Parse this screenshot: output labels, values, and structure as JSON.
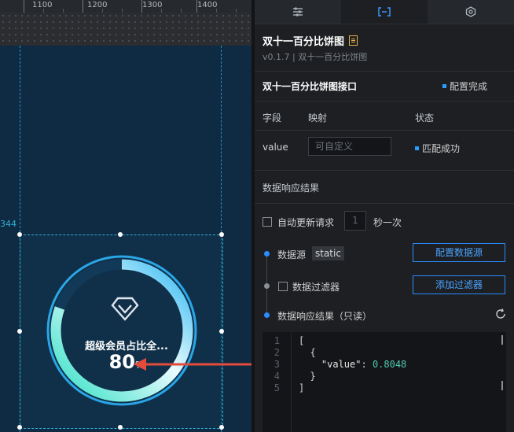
{
  "ruler": {
    "ticks": [
      "1100",
      "1200",
      "1300",
      "1400"
    ]
  },
  "canvas": {
    "coord_label": "344",
    "pie": {
      "label": "超级会员占比全...",
      "value": "80",
      "unit": "%",
      "percent": 0.8048
    }
  },
  "panel": {
    "tabs": [
      {
        "icon": "sliders-icon",
        "active": false
      },
      {
        "icon": "data-brackets-icon",
        "active": true
      },
      {
        "icon": "interaction-icon",
        "active": false
      }
    ],
    "title": "双十一百分比饼图",
    "version": "v0.1.7 | 双十一百分比饼图",
    "interface": {
      "name": "双十一百分比饼图接口",
      "status": "配置完成"
    },
    "table": {
      "headers": [
        "字段",
        "映射",
        "状态"
      ],
      "row": {
        "field": "value",
        "map_placeholder": "可自定义",
        "status": "匹配成功"
      }
    },
    "section_title": "数据响应结果",
    "auto_update": {
      "label": "自动更新请求",
      "interval": "1",
      "unit": "秒一次"
    },
    "datasource": {
      "label": "数据源",
      "type": "static",
      "button": "配置数据源"
    },
    "filter": {
      "label": "数据过滤器",
      "button": "添加过滤器"
    },
    "result": {
      "label": "数据响应结果（只读）"
    },
    "code": {
      "line_numbers": [
        "1",
        "2",
        "3",
        "4",
        "5"
      ],
      "lines": [
        "[",
        "  {",
        "    \"value\": 0.8048",
        "  }",
        "]"
      ],
      "key": "\"value\"",
      "value": "0.8048"
    }
  },
  "colors": {
    "accent": "#2b8cff",
    "arrow": "#e34b3b",
    "ring_start": "#32e0c4",
    "ring_end": "#2cb6f0"
  }
}
